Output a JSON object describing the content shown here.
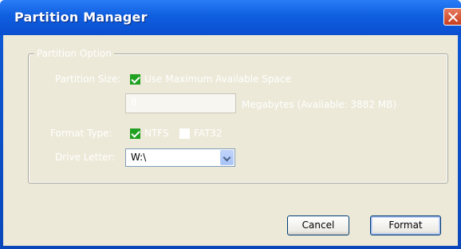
{
  "window": {
    "title": "Partition Manager"
  },
  "group": {
    "legend": "Partition Option"
  },
  "partition_size": {
    "label": "Partition Size:",
    "checkbox_label": "Use Maximum Available Space",
    "checked": true,
    "value": "8",
    "unit_text": "Megabytes (Avaliable: 3882 MB)"
  },
  "format_type": {
    "label": "Format Type:",
    "options": [
      {
        "label": "NTFS",
        "checked": true
      },
      {
        "label": "FAT32",
        "checked": false
      }
    ]
  },
  "drive_letter": {
    "label": "Drive Letter:",
    "value": "W:\\"
  },
  "buttons": {
    "cancel": "Cancel",
    "format": "Format"
  },
  "colors": {
    "titlebar": "#0a4fd0",
    "dialog_bg": "#ece9d8",
    "check_green": "#21a121"
  }
}
